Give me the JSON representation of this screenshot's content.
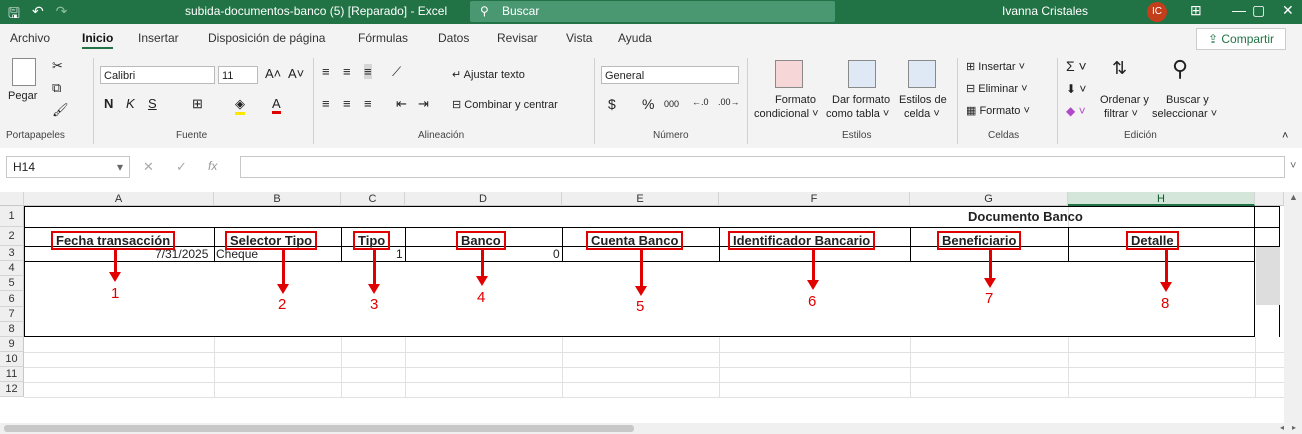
{
  "titlebar": {
    "doc_title": "subida-documentos-banco (5) [Reparado]  -  Excel",
    "search_placeholder": "Buscar",
    "user_name": "Ivanna Cristales",
    "user_initials": "IC",
    "qat_save": "🖫",
    "qat_undo": "↶",
    "qat_redo": "↷",
    "win_ribbon": "⊞",
    "win_min": "—",
    "win_max": "▢",
    "win_close": "✕"
  },
  "tabs": [
    "Archivo",
    "Inicio",
    "Insertar",
    "Disposición de página",
    "Fórmulas",
    "Datos",
    "Revisar",
    "Vista",
    "Ayuda"
  ],
  "share_label": "Compartir",
  "ribbon": {
    "paste": "Pegar",
    "font_name": "Calibri",
    "font_size": "11",
    "bold": "N",
    "italic": "K",
    "underline": "S",
    "wrap_text": "Ajustar texto",
    "merge_center": "Combinar y centrar",
    "number_format": "General",
    "currency": "$",
    "percent": "%",
    "thousands": "000",
    "cond_format": [
      "Formato",
      "condicional ˅"
    ],
    "format_table": [
      "Dar formato",
      "como tabla ˅"
    ],
    "cell_styles": [
      "Estilos de",
      "celda ˅"
    ],
    "insert": "Insertar",
    "delete": "Eliminar",
    "format": "Formato",
    "sort_filter": [
      "Ordenar y",
      "filtrar ˅"
    ],
    "find_select": [
      "Buscar y",
      "seleccionar ˅"
    ],
    "groups": {
      "clipboard": "Portapapeles",
      "font": "Fuente",
      "alignment": "Alineación",
      "number": "Número",
      "styles": "Estilos",
      "cells": "Celdas",
      "editing": "Edición"
    }
  },
  "formula_bar": {
    "name_box": "H14",
    "fx": "fx",
    "value": ""
  },
  "columns": [
    "A",
    "B",
    "C",
    "D",
    "E",
    "F",
    "G",
    "H"
  ],
  "rows": [
    "1",
    "2",
    "3",
    "4",
    "5",
    "6",
    "7",
    "8",
    "9",
    "10",
    "11",
    "12"
  ],
  "sheet": {
    "title": "Documento Banco",
    "headers": [
      "Fecha transacción",
      "Selector Tipo",
      "Tipo",
      "Banco",
      "Cuenta Banco",
      "Identificador Bancario",
      "Beneficiario",
      "Detalle"
    ],
    "row3": {
      "a": "7/31/2025",
      "b": "Cheque",
      "c": "1",
      "d": "0"
    },
    "markers": [
      "1",
      "2",
      "3",
      "4",
      "5",
      "6",
      "7",
      "8"
    ]
  }
}
